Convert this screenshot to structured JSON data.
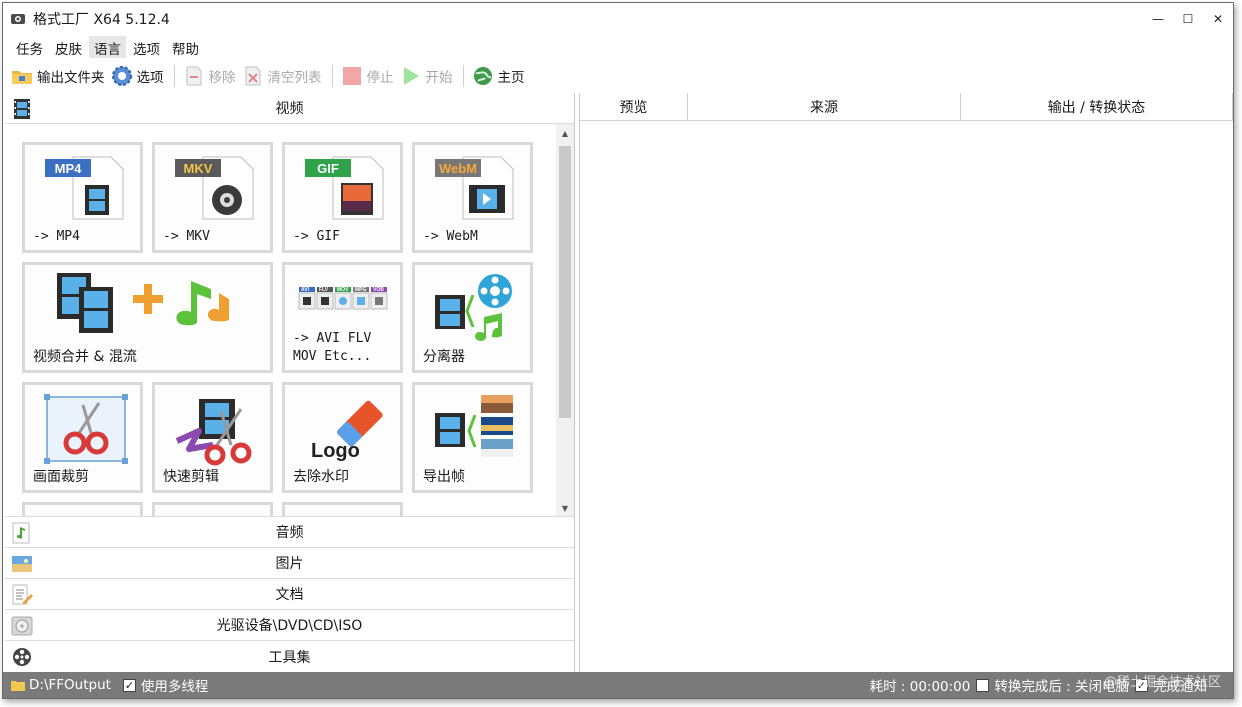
{
  "window": {
    "title": "格式工厂 X64 5.12.4",
    "controls": [
      "—",
      "☐",
      "✕"
    ]
  },
  "menu": [
    "任务",
    "皮肤",
    "语言",
    "选项",
    "帮助"
  ],
  "toolbar": {
    "output_folder": "输出文件夹",
    "options": "选项",
    "remove": "移除",
    "clear_list": "清空列表",
    "stop": "停止",
    "start": "开始",
    "home": "主页"
  },
  "categories": {
    "video": "视频",
    "audio": "音频",
    "image": "图片",
    "document": "文档",
    "disc": "光驱设备\\DVD\\CD\\ISO",
    "tools": "工具集"
  },
  "video_tiles": {
    "mp4": {
      "badge": "MP4",
      "label": "-> MP4"
    },
    "mkv": {
      "badge": "MKV",
      "label": "-> MKV"
    },
    "gif": {
      "badge": "GIF",
      "label": "-> GIF"
    },
    "webm": {
      "badge": "WebM",
      "label": "-> WebM"
    },
    "merge": {
      "label": "视频合并 & 混流"
    },
    "other": {
      "label": "-> AVI FLV\nMOV Etc...",
      "mini_badges": [
        "AVI",
        "FLV",
        "MOV",
        "MPG",
        "VOB"
      ]
    },
    "splitter": {
      "label": "分离器"
    },
    "crop": {
      "label": "画面裁剪"
    },
    "quick_cut": {
      "label": "快速剪辑"
    },
    "remove_logo": {
      "label": "去除水印",
      "art_text": "Logo"
    },
    "export_frames": {
      "label": "导出帧"
    }
  },
  "task_columns": [
    "预览",
    "来源",
    "输出 / 转换状态"
  ],
  "status": {
    "output_path": "D:\\FFOutput",
    "multithread": "使用多线程",
    "elapsed": "耗时 : 00:00:00",
    "after_done": "转换完成后 : 关闭电脑",
    "notify": "完成通知",
    "watermark": "@稀土掘金技术社区"
  },
  "colors": {
    "mp4_badge": "#3b6fc2",
    "mkv_badge": "#5a5a5a",
    "gif_badge": "#2fa34a",
    "webm_badge": "#777777",
    "statusbar": "#7a7a7a",
    "tile_border": "#d9d9d9"
  }
}
